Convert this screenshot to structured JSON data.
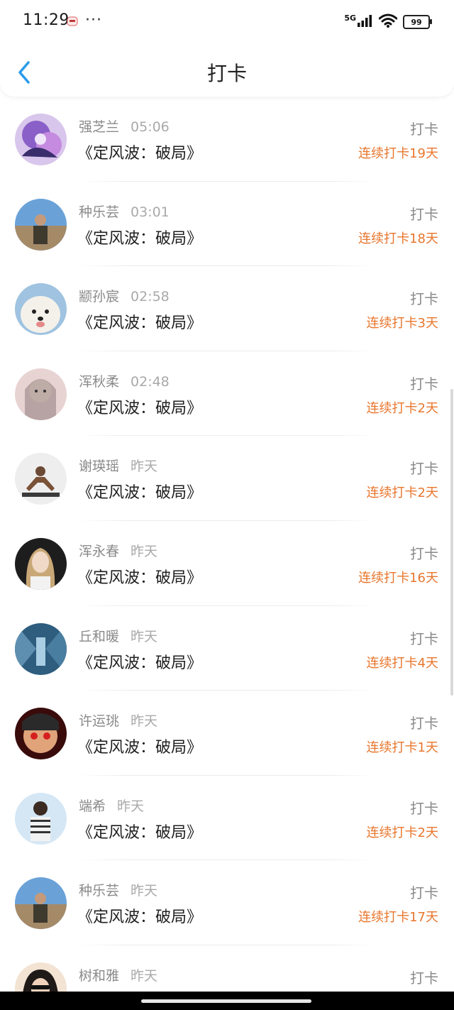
{
  "status_bar": {
    "time": "11:29",
    "more": "···",
    "network": "5G",
    "battery": "99"
  },
  "nav": {
    "title": "打卡",
    "back_icon": "chevron-left-icon",
    "accent_color": "#2a9bea"
  },
  "streak_color": "#e8762d",
  "items": [
    {
      "name": "强芝兰",
      "time": "05:06",
      "title": "《定风波：破局》",
      "action": "打卡",
      "streak": "连续打卡19天"
    },
    {
      "name": "种乐芸",
      "time": "03:01",
      "title": "《定风波：破局》",
      "action": "打卡",
      "streak": "连续打卡18天"
    },
    {
      "name": "颛孙宸",
      "time": "02:58",
      "title": "《定风波：破局》",
      "action": "打卡",
      "streak": "连续打卡3天"
    },
    {
      "name": "浑秋柔",
      "time": "02:48",
      "title": "《定风波：破局》",
      "action": "打卡",
      "streak": "连续打卡2天"
    },
    {
      "name": "谢瑛瑶",
      "time": "昨天",
      "title": "《定风波：破局》",
      "action": "打卡",
      "streak": "连续打卡2天"
    },
    {
      "name": "浑永春",
      "time": "昨天",
      "title": "《定风波：破局》",
      "action": "打卡",
      "streak": "连续打卡16天"
    },
    {
      "name": "丘和暖",
      "time": "昨天",
      "title": "《定风波：破局》",
      "action": "打卡",
      "streak": "连续打卡4天"
    },
    {
      "name": "许运珧",
      "time": "昨天",
      "title": "《定风波：破局》",
      "action": "打卡",
      "streak": "连续打卡1天"
    },
    {
      "name": "端希",
      "time": "昨天",
      "title": "《定风波：破局》",
      "action": "打卡",
      "streak": "连续打卡2天"
    },
    {
      "name": "种乐芸",
      "time": "昨天",
      "title": "《定风波：破局》",
      "action": "打卡",
      "streak": "连续打卡17天"
    },
    {
      "name": "树和雅",
      "time": "昨天",
      "title": "",
      "action": "打卡",
      "streak": ""
    }
  ]
}
